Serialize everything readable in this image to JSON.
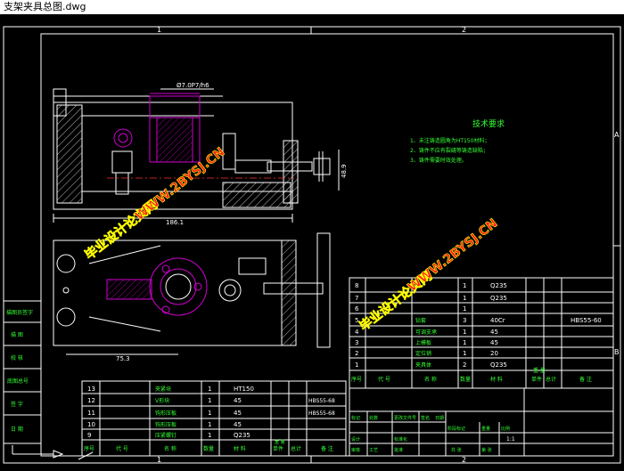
{
  "window": {
    "title": "支架夹具总图.dwg"
  },
  "frame": {
    "zone_top": [
      "1",
      "2"
    ],
    "zone_right": [
      "A",
      "B"
    ],
    "zone_bottom": [
      "1",
      "2"
    ]
  },
  "dimensions": {
    "fit": "Ø7.0P7/h6",
    "height": "48.9",
    "length_top": "186.1",
    "length_bottom": "75.3"
  },
  "tech_requirements": {
    "title": "技术要求",
    "items": [
      "1、未注铸造圆角为HT150材料；",
      "2、铸件不应有裂缝等铸造缺陷；",
      "3、铸件需要时效处理。"
    ]
  },
  "watermarks": [
    "毕业设计论文网",
    "WWW.2BYSJ.CN",
    "毕业设计论文网",
    "WWW.2BYSJ.CN"
  ],
  "left_table": {
    "cells": [
      "描图员签字",
      "描 图",
      "校 核",
      "底图总号",
      "签 字",
      "日 期"
    ]
  },
  "bom_right": {
    "rows": [
      {
        "no": "8",
        "name": "",
        "qty": "1",
        "mat": "Q235",
        "note": ""
      },
      {
        "no": "7",
        "name": "",
        "qty": "1",
        "mat": "Q235",
        "note": ""
      },
      {
        "no": "6",
        "name": "",
        "qty": "1",
        "mat": "",
        "note": ""
      },
      {
        "no": "5",
        "name": "钻套",
        "qty": "3",
        "mat": "40Cr",
        "note": "HBS55-60"
      },
      {
        "no": "4",
        "name": "可调支承",
        "qty": "1",
        "mat": "45",
        "note": ""
      },
      {
        "no": "3",
        "name": "上模板",
        "qty": "1",
        "mat": "45",
        "note": ""
      },
      {
        "no": "2",
        "name": "定位销",
        "qty": "1",
        "mat": "20",
        "note": ""
      },
      {
        "no": "1",
        "name": "夹具体",
        "qty": "2",
        "mat": "Q235",
        "note": ""
      }
    ],
    "header": [
      "序号",
      "代 号",
      "名 称",
      "数量",
      "材 料",
      "单件",
      "总计",
      "备 注"
    ],
    "weight": "重 量"
  },
  "bom_left": {
    "rows": [
      {
        "no": "13",
        "name": "夹紧块",
        "qty": "1",
        "mat": "HT150",
        "note": ""
      },
      {
        "no": "12",
        "name": "V形块",
        "qty": "1",
        "mat": "45",
        "note": "HBS55-68"
      },
      {
        "no": "11",
        "name": "钩形压板",
        "qty": "1",
        "mat": "45",
        "note": "HBS55-68"
      },
      {
        "no": "10",
        "name": "钩形压板",
        "qty": "1",
        "mat": "45",
        "note": ""
      },
      {
        "no": "9",
        "name": "压紧螺钉",
        "qty": "1",
        "mat": "Q235",
        "note": ""
      }
    ],
    "header": [
      "序号",
      "代 号",
      "名 称",
      "数量",
      "材 料",
      "单件",
      "总计",
      "备 注"
    ],
    "weight": "重 量"
  },
  "title_block": {
    "scale": "1:1",
    "labels": [
      "标记",
      "处数",
      "更改文件号",
      "签名",
      "日期",
      "设计",
      "标准化",
      "审核",
      "工艺",
      "批准",
      "阶段标记",
      "重量",
      "比例",
      "共 张",
      "第 张"
    ]
  }
}
